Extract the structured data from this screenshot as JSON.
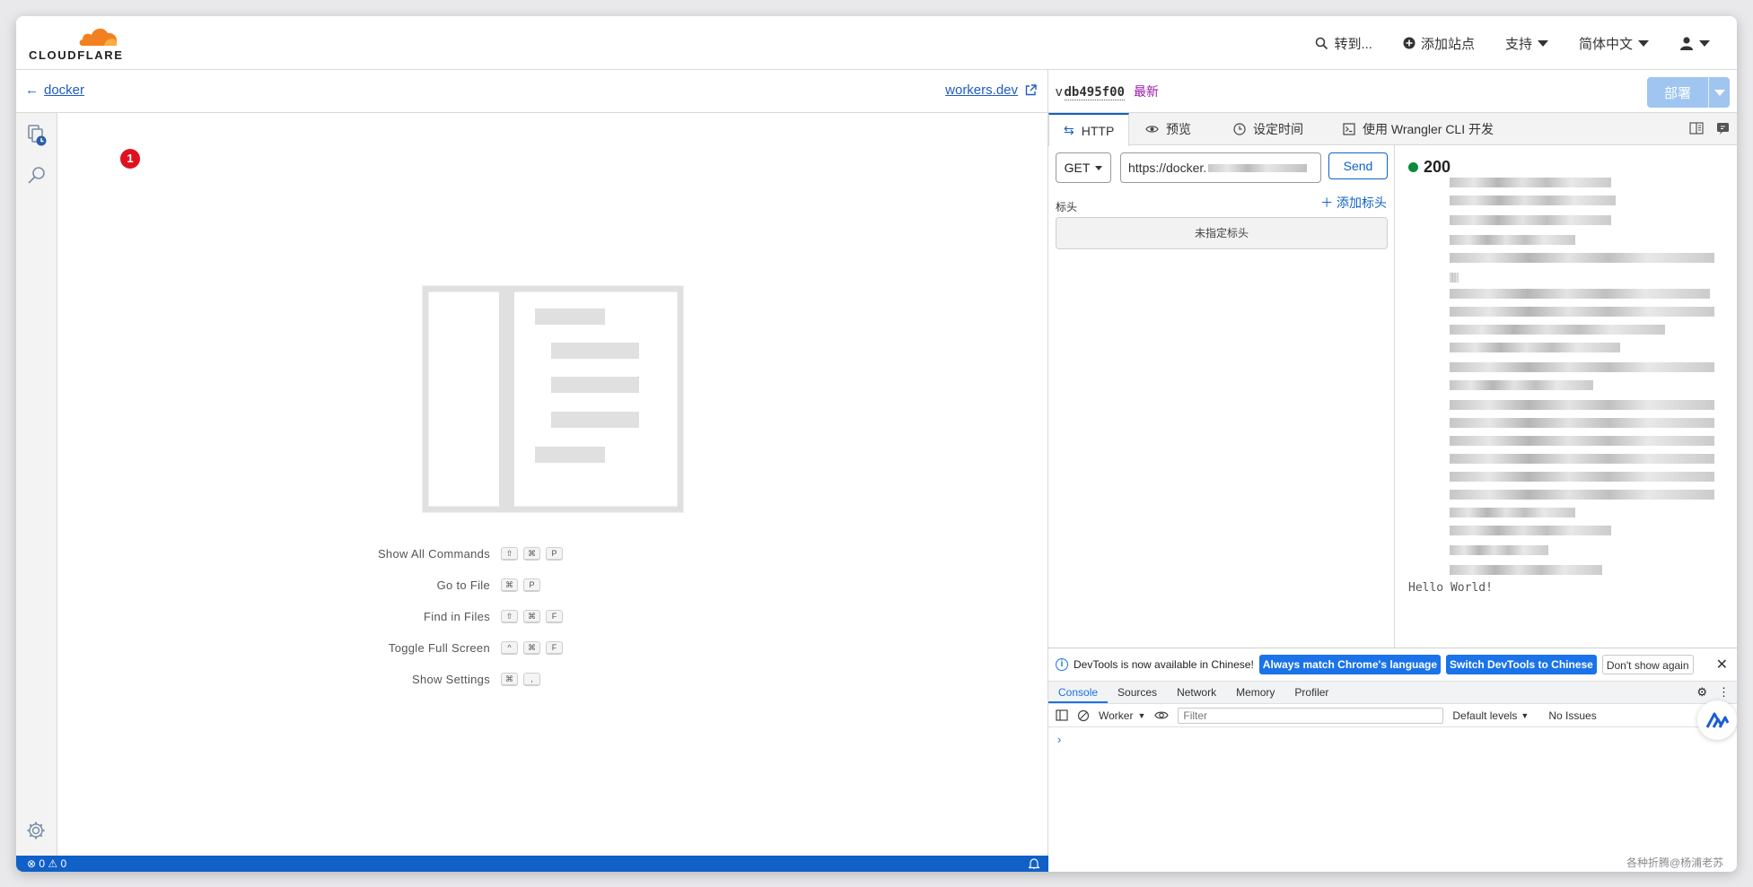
{
  "app": {
    "logo_text": "CLOUDFLARE"
  },
  "topnav": {
    "goto": "转到...",
    "add_site": "添加站点",
    "support": "支持",
    "language": "简体中文"
  },
  "editor": {
    "back_label": "docker",
    "workers_link": "workers.dev",
    "badge_count": "1",
    "shortcuts": [
      {
        "label": "Show All Commands",
        "keys": [
          "⇧",
          "⌘",
          "P"
        ]
      },
      {
        "label": "Go to File",
        "keys": [
          "⌘",
          "P"
        ]
      },
      {
        "label": "Find in Files",
        "keys": [
          "⇧",
          "⌘",
          "F"
        ]
      },
      {
        "label": "Toggle Full Screen",
        "keys": [
          "^",
          "⌘",
          "F"
        ]
      },
      {
        "label": "Show Settings",
        "keys": [
          "⌘",
          ","
        ]
      }
    ],
    "status_errors": "0",
    "status_warnings": "0"
  },
  "right": {
    "version_prefix": "v",
    "version_hash": "db495f00",
    "version_tag": "最新",
    "deploy_label": "部署",
    "tabs": [
      "HTTP",
      "预览",
      "设定时间",
      "使用 Wrangler CLI 开发"
    ],
    "method": "GET",
    "url": "https://docker.",
    "send_label": "Send",
    "headers_label": "标头",
    "add_header": "添加标头",
    "no_headers": "未指定标头",
    "status_code": "200",
    "response_tail": "Hello World!"
  },
  "devtools": {
    "info_text": "DevTools is now available in Chinese!",
    "btn_match": "Always match Chrome's language",
    "btn_switch": "Switch DevTools to Chinese",
    "btn_dont": "Don't show again",
    "tabs": [
      "Console",
      "Sources",
      "Network",
      "Memory",
      "Profiler"
    ],
    "context": "Worker",
    "filter_placeholder": "Filter",
    "levels": "Default levels",
    "issues": "No Issues"
  },
  "watermark": "各种折腾@杨浦老苏",
  "colors": {
    "accent": "#1060c8",
    "brand_orange": "#f38020",
    "status_ok": "#0a8a3a",
    "badge": "#e0101e"
  }
}
